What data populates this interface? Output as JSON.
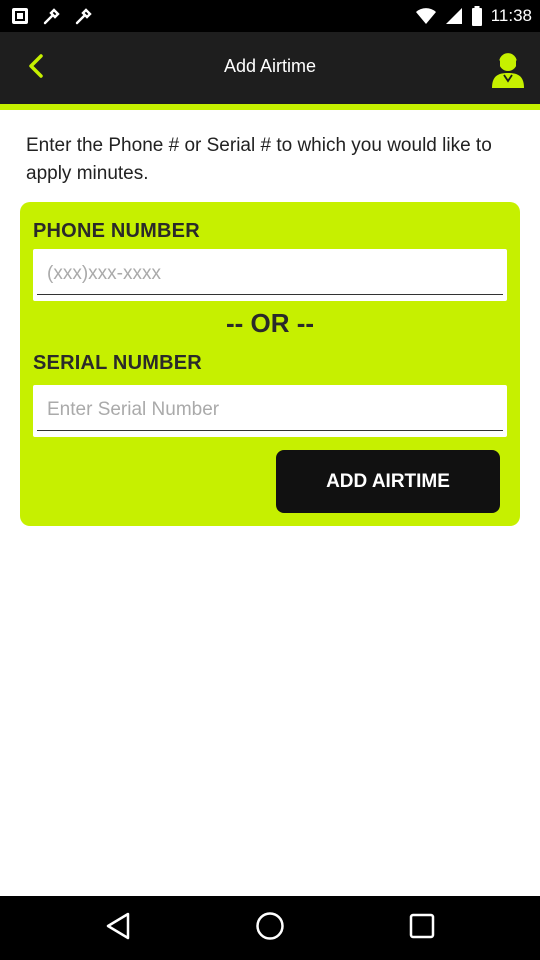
{
  "status_bar": {
    "time": "11:38",
    "icons": [
      "notification-icon",
      "settings-icon",
      "wifi-icon",
      "signal-icon",
      "battery-icon"
    ]
  },
  "app_bar": {
    "title": "Add Airtime",
    "back_icon": "chevron-left-icon",
    "support_icon": "support-agent-icon"
  },
  "colors": {
    "accent": "#c6f000",
    "app_bar_bg": "#1e1e1e",
    "button_bg": "#111111"
  },
  "instruction": "Enter the Phone # or Serial # to which you would like to apply minutes.",
  "form": {
    "phone_label": "PHONE NUMBER",
    "phone_placeholder": "(xxx)xxx-xxxx",
    "phone_value": "",
    "or_text": "-- OR --",
    "serial_label": "SERIAL NUMBER",
    "serial_placeholder": "Enter Serial Number",
    "serial_value": "",
    "submit_label": "ADD AIRTIME"
  },
  "nav_bar": {
    "icons": [
      "back-triangle-icon",
      "home-circle-icon",
      "recents-square-icon"
    ]
  }
}
